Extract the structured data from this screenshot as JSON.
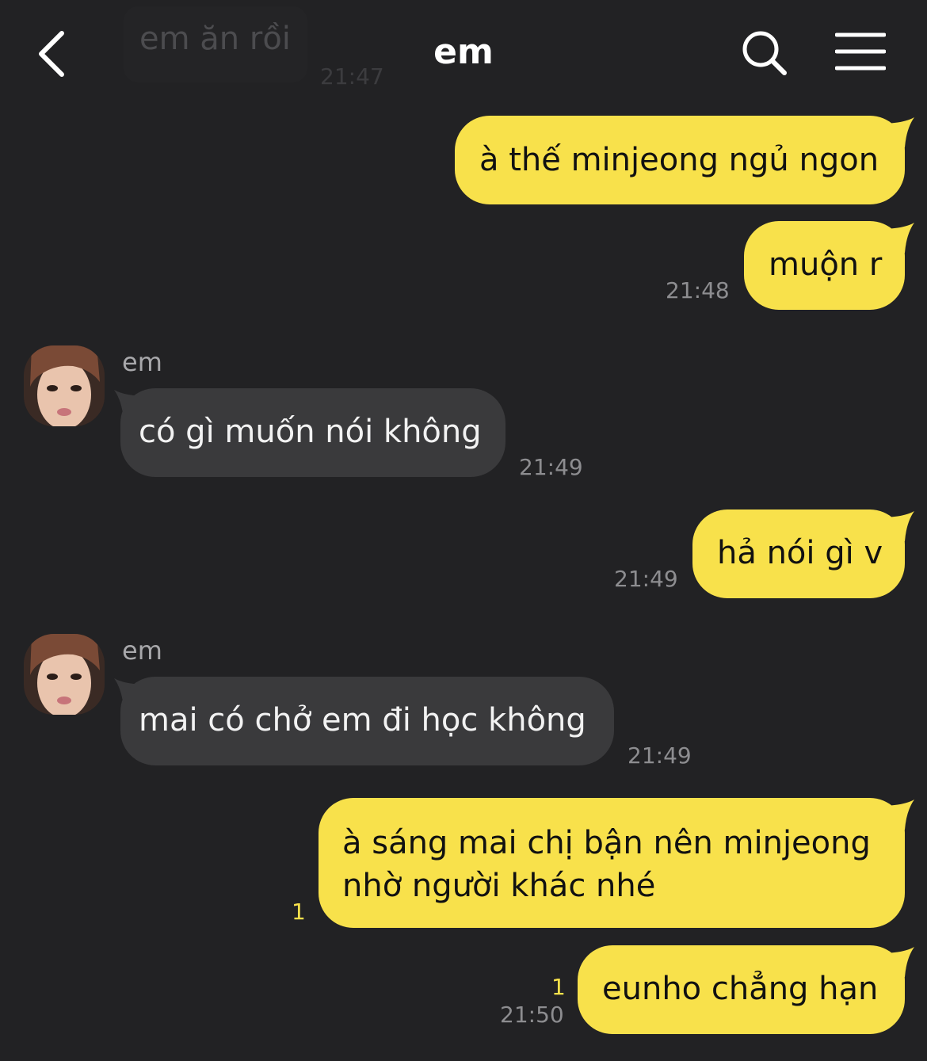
{
  "header": {
    "title": "em",
    "back_icon": "chevron-left-icon",
    "search_icon": "search-icon",
    "menu_icon": "menu-icon"
  },
  "faded_message": {
    "text": "em ăn rồi",
    "time": "21:47"
  },
  "messages": [
    {
      "side": "me",
      "text": "à thế minjeong ngủ ngon"
    },
    {
      "side": "me",
      "text": "muộn r",
      "time": "21:48"
    },
    {
      "side": "them",
      "sender": "em",
      "text": "có gì muốn nói không",
      "time": "21:49"
    },
    {
      "side": "me",
      "text": "hả nói gì v",
      "time": "21:49"
    },
    {
      "side": "them",
      "sender": "em",
      "text": "mai có chở em đi học không",
      "time": "21:49"
    },
    {
      "side": "me",
      "lines": [
        "à sáng mai chị bận nên minjeong",
        "nhờ người khác nhé"
      ],
      "unread": "1"
    },
    {
      "side": "me",
      "text": "eunho chẳng hạn",
      "unread": "1",
      "time": "21:50"
    }
  ],
  "colors": {
    "background": "#222224",
    "my_bubble": "#f8e14b",
    "their_bubble": "#3a3a3c",
    "unread_count": "#f8e14b"
  }
}
